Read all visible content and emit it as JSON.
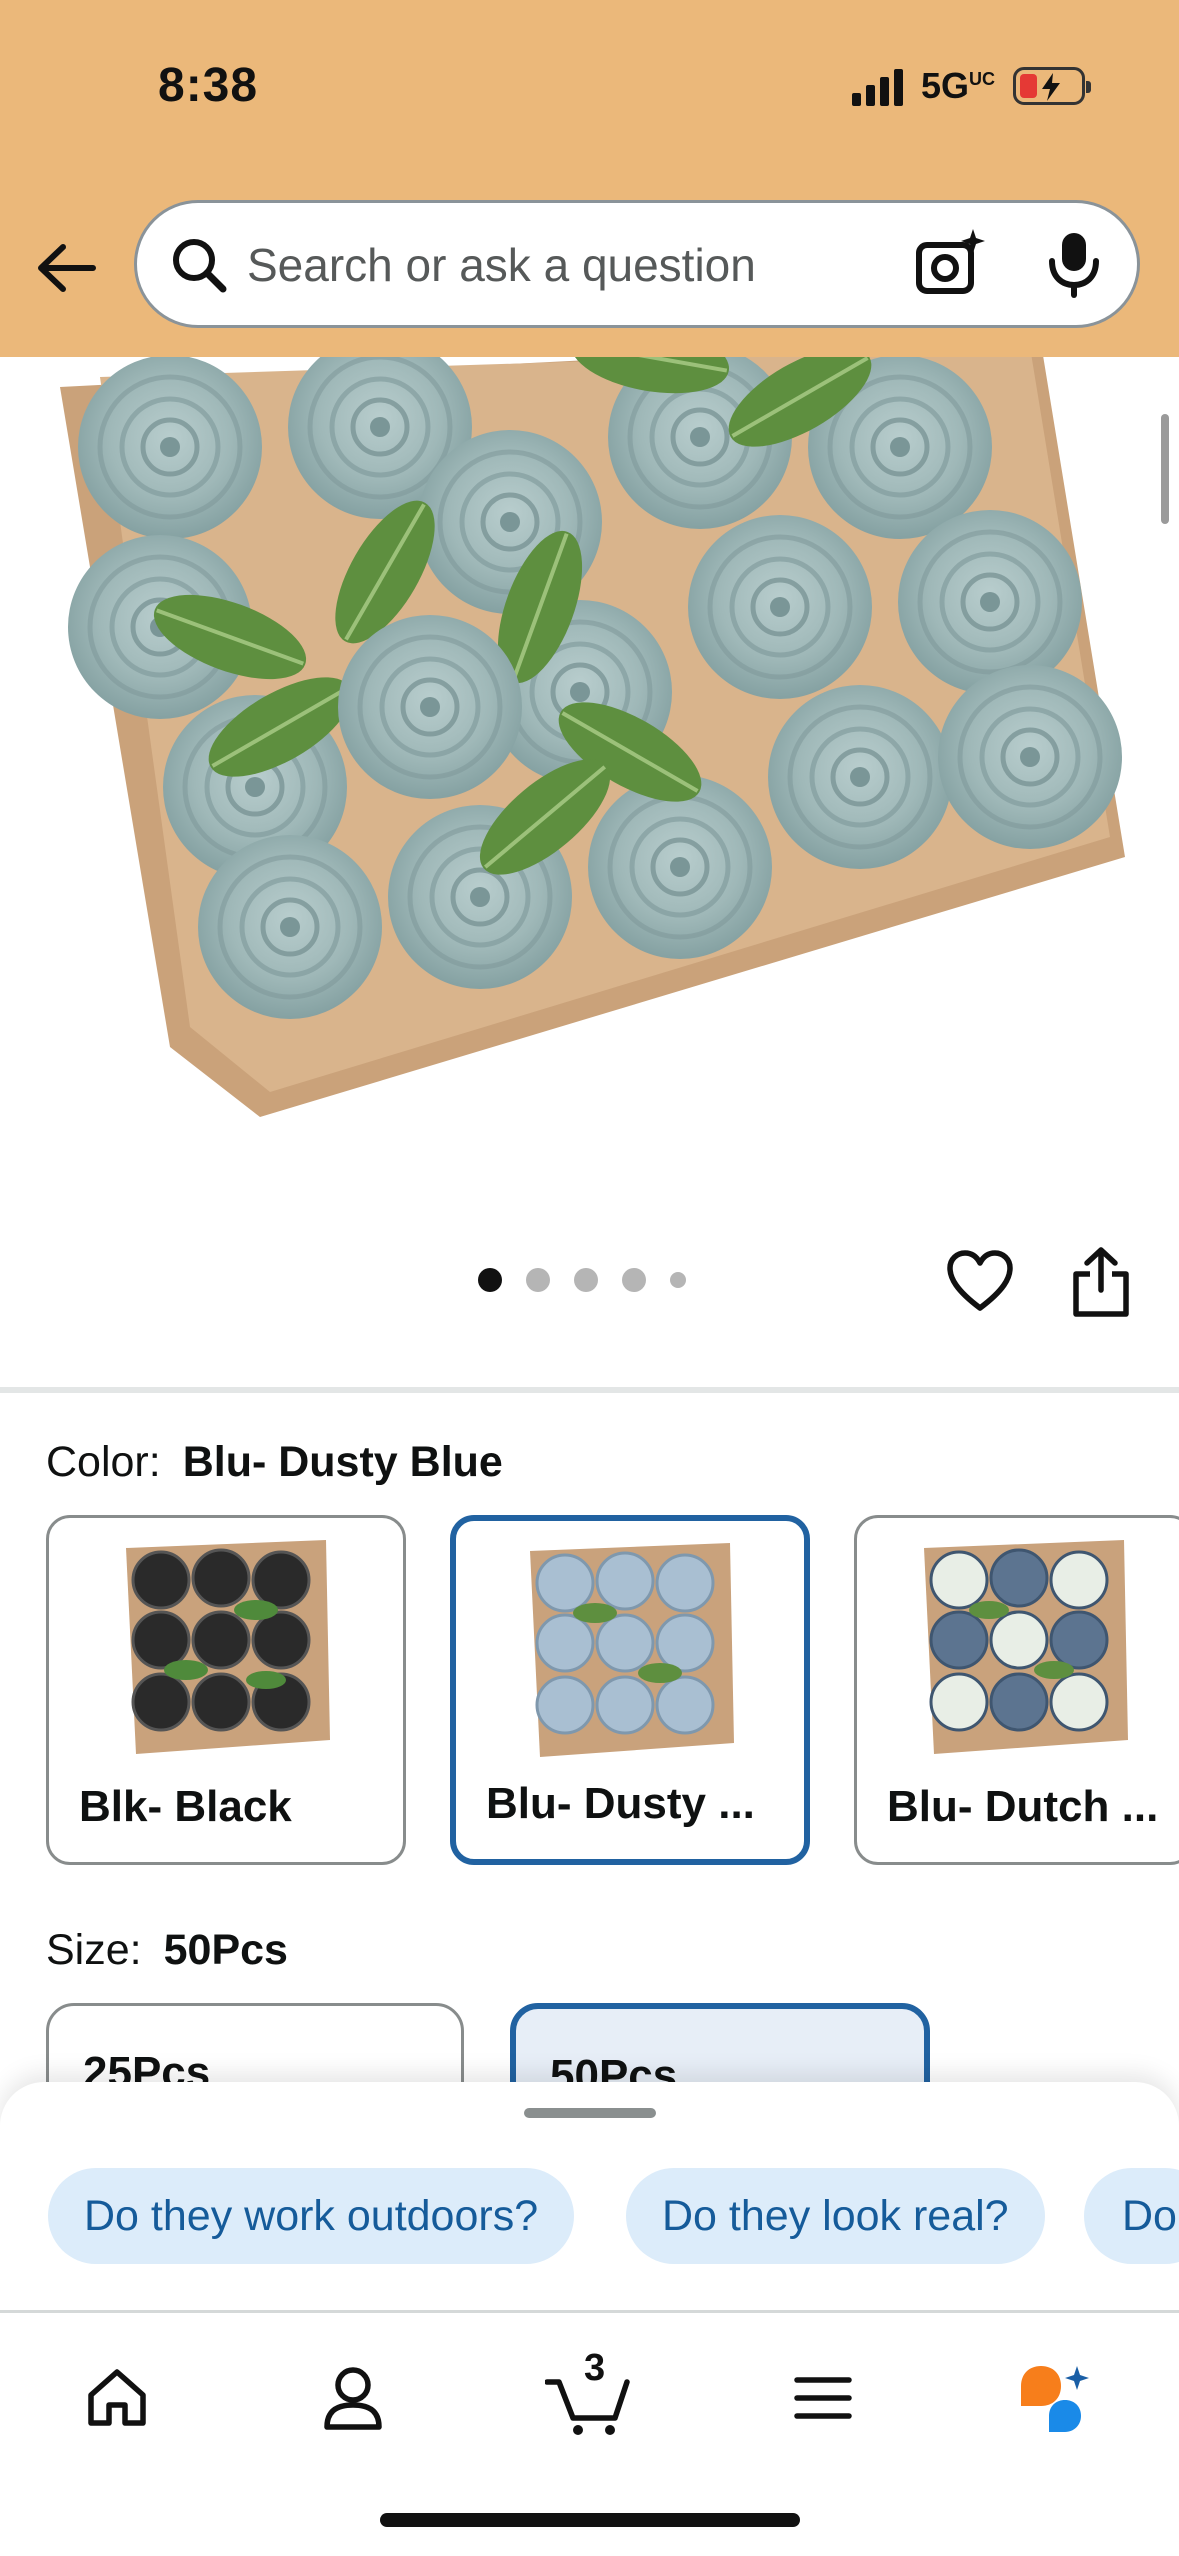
{
  "status_bar": {
    "time": "8:38",
    "network": "5G",
    "network_suffix": "UC",
    "battery_state": "low-charging"
  },
  "header": {
    "back_icon": "arrow-left-icon",
    "search": {
      "placeholder": "Search or ask a question",
      "camera_icon": "camera-sparkle-icon",
      "mic_icon": "microphone-icon"
    }
  },
  "product": {
    "image_alt": "Box of dusty blue artificial foam roses with green leaves",
    "gallery": {
      "total": 5,
      "active": 1
    },
    "actions": {
      "heart_icon": "heart-icon",
      "share_icon": "share-icon"
    }
  },
  "color_selector": {
    "label": "Color:",
    "selected": "Blu- Dusty Blue",
    "options": [
      {
        "label": "Blk- Black",
        "thumb_color": "#2a2a2a"
      },
      {
        "label": "Blu- Dusty ...",
        "thumb_color": "#a9bfd2"
      },
      {
        "label": "Blu- Dutch ...",
        "thumb_color": "#5c7490"
      }
    ]
  },
  "size_selector": {
    "label": "Size:",
    "selected": "50Pcs",
    "options": [
      "25Pcs",
      "50Pcs"
    ]
  },
  "questions": {
    "chips": [
      "Do they work outdoors?",
      "Do they look real?",
      "Do"
    ]
  },
  "tabbar": {
    "items": [
      {
        "name": "home",
        "icon": "home-icon"
      },
      {
        "name": "account",
        "icon": "person-icon"
      },
      {
        "name": "cart",
        "icon": "cart-icon",
        "count": "3"
      },
      {
        "name": "menu",
        "icon": "menu-icon"
      },
      {
        "name": "rufus",
        "icon": "rufus-chat-icon"
      }
    ]
  },
  "colors": {
    "header_bg": "#ebb87a",
    "accent_blue": "#2162a1",
    "chip_bg": "#dcecfa",
    "chip_text": "#155b9a",
    "rufus_orange": "#f77e1b",
    "rufus_blue": "#1a8ae8"
  }
}
